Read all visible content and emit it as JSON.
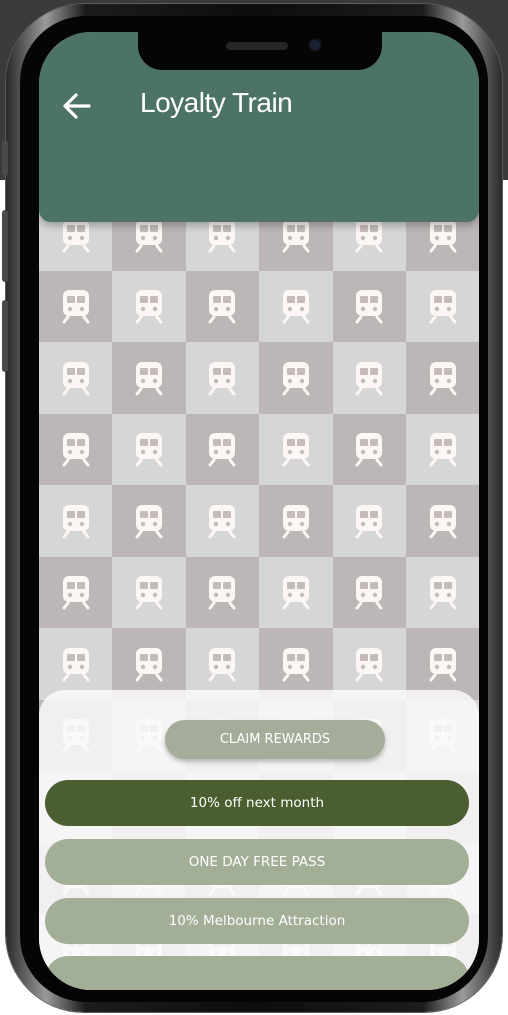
{
  "header": {
    "title": "Loyalty Train",
    "back_icon": "arrow-left-icon",
    "background": "#4d7268"
  },
  "pattern": {
    "icon": "train-icon",
    "light_tile": "#d6d6d6",
    "dark_tile": "#bdb6b6",
    "icon_color": "#fcf6f4"
  },
  "rewards": {
    "claim_label": "CLAIM REWARDS",
    "items": [
      {
        "label": "10% off next month",
        "selected": true
      },
      {
        "label": "ONE DAY FREE PASS",
        "selected": false
      },
      {
        "label": "10% Melbourne Attraction",
        "selected": false
      },
      {
        "label": "",
        "selected": false
      }
    ],
    "selected_color": "#4a5e30",
    "default_color": "#a2ae96"
  }
}
